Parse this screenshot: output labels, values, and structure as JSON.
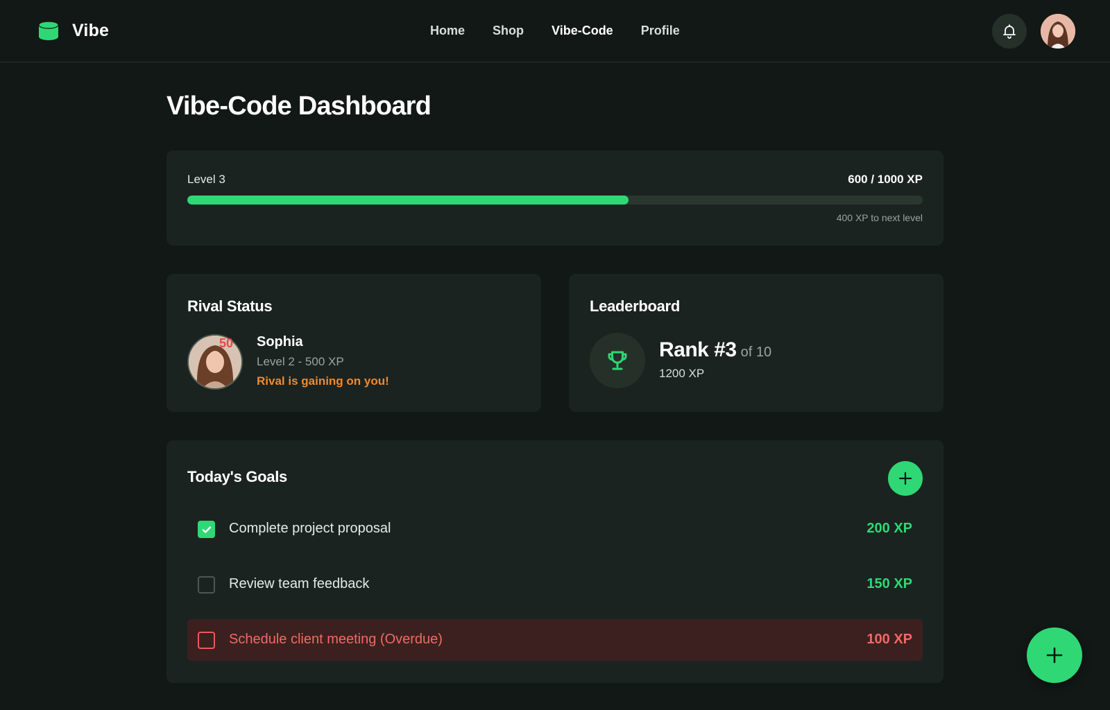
{
  "app": {
    "name": "Vibe",
    "accent": "#2fd875"
  },
  "nav": {
    "items": [
      {
        "label": "Home"
      },
      {
        "label": "Shop"
      },
      {
        "label": "Vibe-Code"
      },
      {
        "label": "Profile"
      }
    ],
    "active": "Vibe-Code"
  },
  "header": {
    "icons": [
      "bell-icon",
      "avatar"
    ]
  },
  "page": {
    "title": "Vibe-Code Dashboard"
  },
  "xp": {
    "level_label": "Level 3",
    "progress_text": "600 / 1000 XP",
    "progress_fraction": 0.6,
    "next_level_text": "400 XP to next level"
  },
  "rival": {
    "title": "Rival Status",
    "name": "Sophia",
    "level_text": "Level 2 - 500 XP",
    "badge": "50",
    "warning": "Rival is gaining on you!",
    "warning_color": "#f08a2e"
  },
  "leaderboard": {
    "title": "Leaderboard",
    "rank": "Rank #3",
    "of_text": "of 10",
    "xp_text": "1200 XP",
    "icon": "trophy-icon"
  },
  "goals": {
    "title": "Today's Goals",
    "items": [
      {
        "text": "Complete project proposal",
        "xp": "200 XP",
        "checked": true,
        "overdue": false
      },
      {
        "text": "Review team feedback",
        "xp": "150 XP",
        "checked": false,
        "overdue": false
      },
      {
        "text": "Schedule client meeting (Overdue)",
        "xp": "100 XP",
        "checked": false,
        "overdue": true
      }
    ],
    "overdue_color": "#ef6a65"
  },
  "fab": {
    "icon": "plus-icon"
  }
}
